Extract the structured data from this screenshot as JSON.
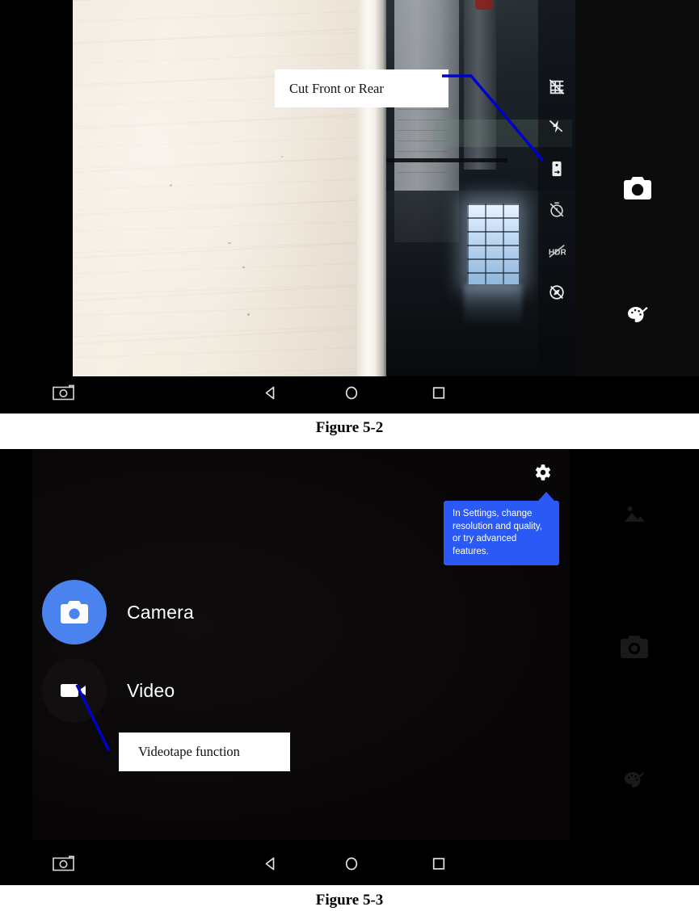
{
  "figure_52": {
    "caption": "Figure 5-2",
    "annotation": {
      "text": "Cut Front or Rear",
      "line_color": "#0000cc"
    },
    "camera_controls": [
      {
        "name": "grid-off-icon",
        "label": "Grid off"
      },
      {
        "name": "flash-off-icon",
        "label": "Flash off"
      },
      {
        "name": "camera-switch-icon",
        "label": "Switch front or rear camera"
      },
      {
        "name": "timer-off-icon",
        "label": "Timer off"
      },
      {
        "name": "hdr-off-icon",
        "label": "HDR off"
      },
      {
        "name": "location-off-icon",
        "label": "Location off"
      }
    ],
    "sidebar_buttons": [
      {
        "name": "shutter-button",
        "label": "Shutter"
      },
      {
        "name": "filter-palette-icon",
        "label": "Filters"
      }
    ],
    "navbar": [
      {
        "name": "nav-screenshot-icon",
        "label": "Screenshot"
      },
      {
        "name": "nav-back-icon",
        "label": "Back"
      },
      {
        "name": "nav-home-icon",
        "label": "Home"
      },
      {
        "name": "nav-recents-icon",
        "label": "Recents"
      }
    ]
  },
  "figure_53": {
    "caption": "Figure 5-3",
    "annotation": {
      "text": "Videotape function",
      "line_color": "#0000cc"
    },
    "settings_icon": {
      "name": "gear-icon",
      "label": "Settings"
    },
    "tooltip": {
      "text": "In Settings, change resolution and quality, or try advanced features.",
      "color": "#2a59f5"
    },
    "modes": [
      {
        "name": "mode-camera",
        "label": "Camera",
        "icon": "camera-icon",
        "active": true,
        "accent": "#4a82ee"
      },
      {
        "name": "mode-video",
        "label": "Video",
        "icon": "videocam-icon",
        "active": false
      }
    ],
    "sidebar_buttons": [
      {
        "name": "gallery-icon",
        "label": "Gallery"
      },
      {
        "name": "shutter-button",
        "label": "Shutter"
      },
      {
        "name": "filter-palette-icon",
        "label": "Filters"
      }
    ],
    "navbar": [
      {
        "name": "nav-screenshot-icon",
        "label": "Screenshot"
      },
      {
        "name": "nav-back-icon",
        "label": "Back"
      },
      {
        "name": "nav-home-icon",
        "label": "Home"
      },
      {
        "name": "nav-recents-icon",
        "label": "Recents"
      }
    ]
  }
}
